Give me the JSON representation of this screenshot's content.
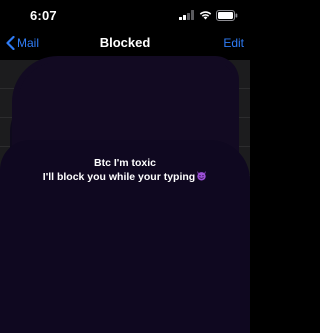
{
  "status_bar": {
    "time": "6:07",
    "icons": [
      "cellular-signal-icon",
      "wifi-icon",
      "battery-icon"
    ]
  },
  "nav": {
    "back_label": "Mail",
    "title": "Blocked",
    "edit_label": "Edit"
  },
  "caption": {
    "line1": "Btc I'm toxic",
    "line2": "I'll block you while your typing"
  },
  "colors": {
    "accent": "#2f7cf6",
    "list_bg": "#1c1c1e",
    "scribble": "#120a22"
  }
}
